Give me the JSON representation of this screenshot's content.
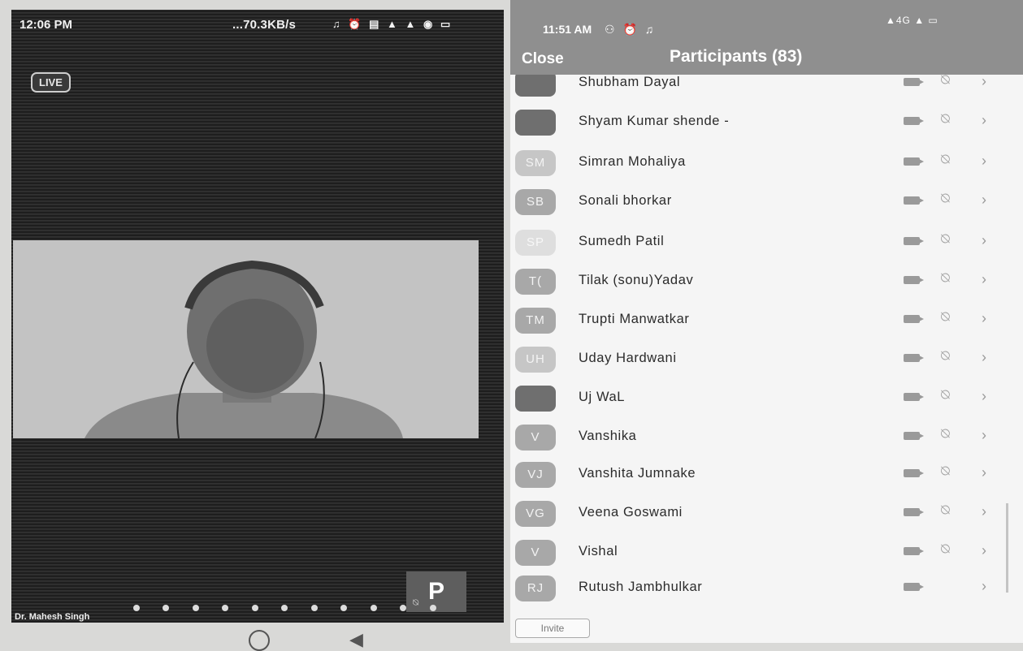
{
  "left_screen": {
    "status_time": "12:06 PM",
    "status_rate": "...70.3KB/s",
    "status_icons": "♫ ⏰ ▤ ▲ ▲ ◉ ▭",
    "live_badge": "LIVE",
    "pip_letter": "P",
    "speaker_name": "Dr. Mahesh Singh",
    "page_dots": 11
  },
  "right_screen": {
    "status_time": "11:51 AM",
    "status_icons_left": "⚇ ⏰ ♫",
    "status_icons_right": "▲4G ▲ ▭",
    "close_label": "Close",
    "title": "Participants (83)",
    "invite_label": "Invite",
    "participants": [
      {
        "name": "Shubham Dayal",
        "initials": "",
        "avatar": "photo",
        "video": true,
        "mic": true
      },
      {
        "name": "Shyam Kumar shende -",
        "initials": "",
        "avatar": "photo",
        "video": true,
        "mic": true
      },
      {
        "name": "Simran Mohaliya",
        "initials": "SM",
        "avatar": "light",
        "video": true,
        "mic": true
      },
      {
        "name": "Sonali bhorkar",
        "initials": "SB",
        "avatar": "normal",
        "video": true,
        "mic": true
      },
      {
        "name": "Sumedh Patil",
        "initials": "SP",
        "avatar": "pale",
        "video": true,
        "mic": true
      },
      {
        "name": "Tilak (sonu)Yadav",
        "initials": "T(",
        "avatar": "normal",
        "video": true,
        "mic": true
      },
      {
        "name": "Trupti Manwatkar",
        "initials": "TM",
        "avatar": "normal",
        "video": true,
        "mic": true
      },
      {
        "name": "Uday Hardwani",
        "initials": "UH",
        "avatar": "light",
        "video": true,
        "mic": true
      },
      {
        "name": "Uj WaL",
        "initials": "",
        "avatar": "photo",
        "video": true,
        "mic": true
      },
      {
        "name": "Vanshika",
        "initials": "V",
        "avatar": "normal",
        "video": true,
        "mic": true
      },
      {
        "name": "Vanshita Jumnake",
        "initials": "VJ",
        "avatar": "normal",
        "video": true,
        "mic": true
      },
      {
        "name": "Veena Goswami",
        "initials": "VG",
        "avatar": "normal",
        "video": true,
        "mic": true
      },
      {
        "name": "Vishal",
        "initials": "V",
        "avatar": "normal",
        "video": true,
        "mic": true
      },
      {
        "name": "Rutush Jambhulkar",
        "initials": "RJ",
        "avatar": "normal",
        "video": true,
        "mic": false
      }
    ]
  },
  "icons": {
    "video": "video-camera-icon",
    "mic": "muted-mic-icon",
    "chevron": "chevron-right-icon"
  }
}
